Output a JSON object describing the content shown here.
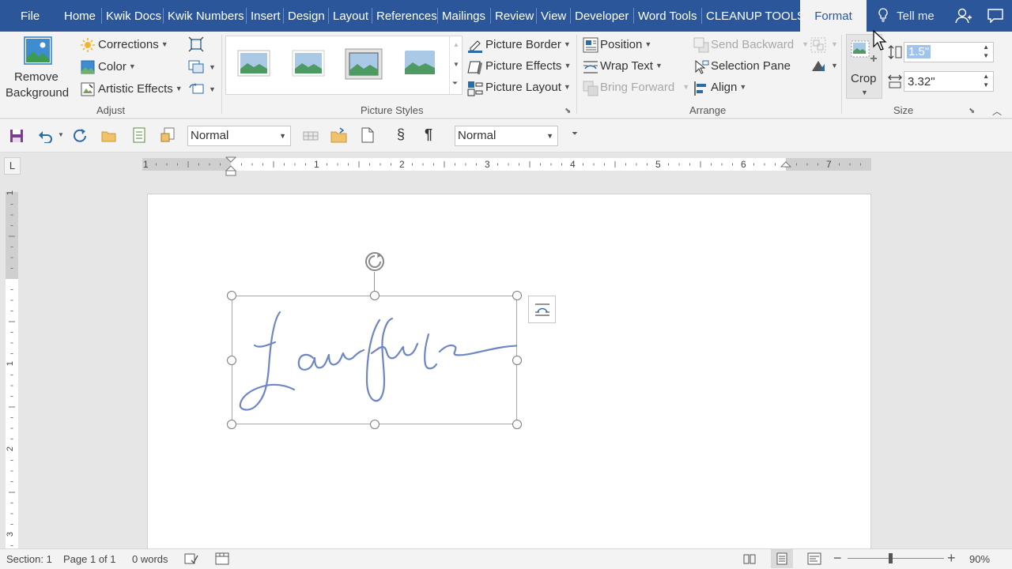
{
  "tabs": {
    "file": "File",
    "home": "Home",
    "kwik_docs": "Kwik Docs",
    "kwik_numbers": "Kwik Numbers",
    "insert": "Insert",
    "design": "Design",
    "layout": "Layout",
    "references": "References",
    "mailings": "Mailings",
    "review": "Review",
    "view": "View",
    "developer": "Developer",
    "word_tools": "Word Tools",
    "cleanup_tools": "CLEANUP TOOLS",
    "format": "Format",
    "tell_me": "Tell me"
  },
  "adjust": {
    "remove_background_1": "Remove",
    "remove_background_2": "Background",
    "corrections": "Corrections",
    "color": "Color",
    "artistic_effects": "Artistic Effects",
    "group_label": "Adjust"
  },
  "picture_styles": {
    "picture_border": "Picture Border",
    "picture_effects": "Picture Effects",
    "picture_layout": "Picture Layout",
    "group_label": "Picture Styles"
  },
  "arrange": {
    "position": "Position",
    "wrap_text": "Wrap Text",
    "bring_forward": "Bring Forward",
    "send_backward": "Send Backward",
    "selection_pane": "Selection Pane",
    "align": "Align",
    "group_label": "Arrange"
  },
  "size": {
    "crop": "Crop",
    "height": "1.5\"",
    "width": "3.32\"",
    "group_label": "Size"
  },
  "qat": {
    "style_left": "Normal",
    "style_right": "Normal",
    "section_sign": "§",
    "pilcrow": "¶"
  },
  "ruler": {
    "h_numbers": [
      "1",
      "1",
      "2",
      "3",
      "4",
      "5",
      "6",
      "7"
    ],
    "v_numbers": [
      "1",
      "1",
      "2",
      "3"
    ],
    "tab_stop": "L"
  },
  "status": {
    "section": "Section: 1",
    "page": "Page 1 of 1",
    "words": "0 words",
    "zoom": "90%"
  },
  "colors": {
    "ribbon_blue": "#2b579a",
    "signature_ink": "#6f86c4",
    "handle": "#7a7a7a"
  }
}
